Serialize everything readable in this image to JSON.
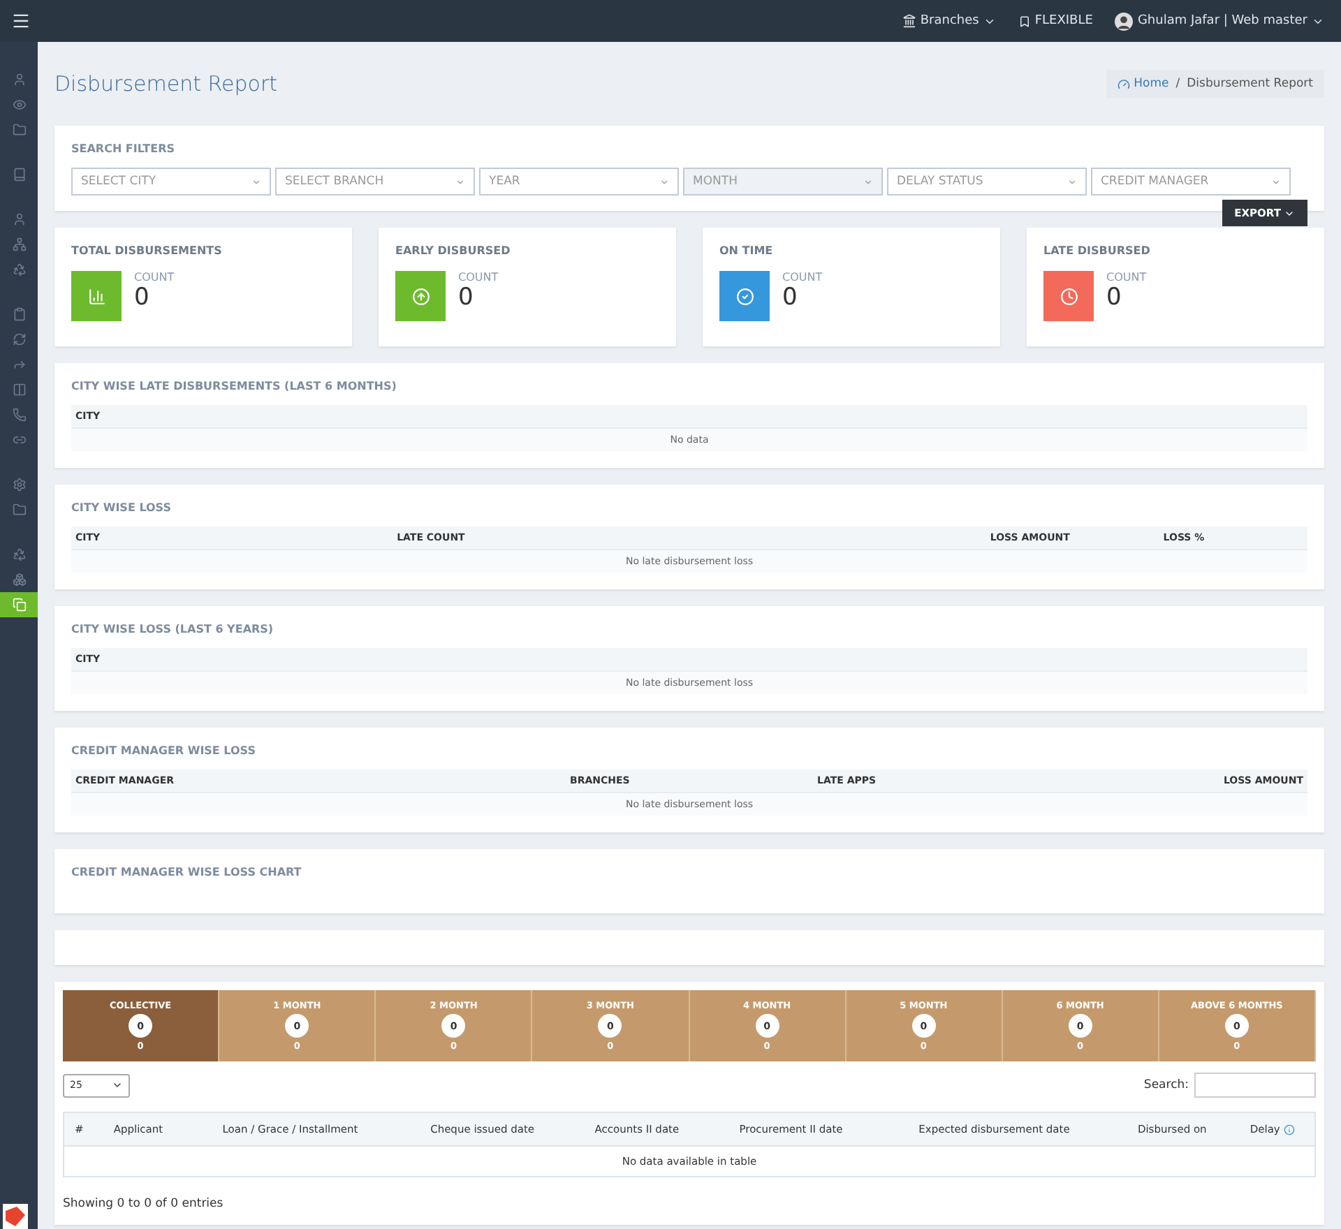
{
  "topbar": {
    "branches": "Branches",
    "plan": "FLEXIBLE",
    "user": "Ghulam Jafar | Web master"
  },
  "sidebar": {
    "items": [
      {
        "selected": false
      },
      {
        "selected": false
      },
      {
        "selected": false
      },
      {
        "selected": false
      },
      {
        "selected": false
      },
      {
        "selected": false
      },
      {
        "selected": false
      },
      {
        "selected": false
      },
      {
        "selected": false
      },
      {
        "selected": false
      },
      {
        "selected": false
      },
      {
        "selected": false
      },
      {
        "selected": false
      },
      {
        "selected": false
      },
      {
        "selected": false
      },
      {
        "selected": false
      },
      {
        "selected": false
      },
      {
        "selected": true
      }
    ]
  },
  "page_title": "Disbursement Report",
  "breadcrumb": [
    {
      "label": "Home"
    },
    {
      "label": "Disbursement Report"
    }
  ],
  "breadcrumb_separator": "/",
  "filters": {
    "title": "SEARCH FILTERS",
    "selects": [
      {
        "placeholder": "SELECT CITY",
        "disabled": false
      },
      {
        "placeholder": "SELECT BRANCH",
        "disabled": false
      },
      {
        "placeholder": "YEAR",
        "disabled": false
      },
      {
        "placeholder": "MONTH",
        "disabled": true
      },
      {
        "placeholder": "DELAY STATUS",
        "disabled": false
      },
      {
        "placeholder": "CREDIT MANAGER",
        "disabled": false
      }
    ],
    "export": "EXPORT"
  },
  "stats": [
    {
      "kind": "chart",
      "title": "TOTAL DISBURSEMENTS",
      "label": "COUNT",
      "value": "0",
      "color": "#6dbb2d"
    },
    {
      "kind": "up",
      "title": "EARLY DISBURSED",
      "label": "COUNT",
      "value": "0",
      "color": "#6dbb2d"
    },
    {
      "kind": "check",
      "title": "ON TIME",
      "label": "COUNT",
      "value": "0",
      "color": "#3598dc"
    },
    {
      "kind": "clock",
      "title": "LATE DISBURSED",
      "label": "COUNT",
      "value": "0",
      "color": "#f36a5a"
    }
  ],
  "sections": [
    {
      "title": "CITY WISE LATE DISBURSEMENTS (LAST 6 MONTHS)",
      "columns": [
        "CITY"
      ],
      "empty": "No data"
    },
    {
      "title": "CITY WISE LOSS",
      "columns": [
        "CITY",
        "LATE COUNT",
        "LOSS AMOUNT",
        "LOSS %"
      ],
      "empty": "No late disbursement loss"
    },
    {
      "title": "CITY WISE LOSS (LAST 6 YEARS)",
      "columns": [
        "CITY"
      ],
      "empty": "No late disbursement loss"
    },
    {
      "title": "CREDIT MANAGER WISE LOSS",
      "columns": [
        "CREDIT MANAGER",
        "BRANCHES",
        "LATE APPS",
        "LOSS AMOUNT"
      ],
      "empty": "No late disbursement loss"
    }
  ],
  "chart_section": {
    "title": "CREDIT MANAGER WISE LOSS CHART"
  },
  "buckets": [
    {
      "label": "COLLECTIVE",
      "count": "0",
      "amount": "0",
      "selected": true
    },
    {
      "label": "1 MONTH",
      "count": "0",
      "amount": "0",
      "selected": false
    },
    {
      "label": "2 MONTH",
      "count": "0",
      "amount": "0",
      "selected": false
    },
    {
      "label": "3 MONTH",
      "count": "0",
      "amount": "0",
      "selected": false
    },
    {
      "label": "4 MONTH",
      "count": "0",
      "amount": "0",
      "selected": false
    },
    {
      "label": "5 MONTH",
      "count": "0",
      "amount": "0",
      "selected": false
    },
    {
      "label": "6 MONTH",
      "count": "0",
      "amount": "0",
      "selected": false
    },
    {
      "label": "ABOVE 6 MONTHS",
      "count": "0",
      "amount": "0",
      "selected": false
    }
  ],
  "page_length": "25",
  "search_label": "Search:",
  "table": {
    "columns": [
      "#",
      "Applicant",
      "Loan / Grace / Installment",
      "Cheque issued date",
      "Accounts II date",
      "Procurement II date",
      "Expected disbursement date",
      "Disbursed on",
      "Delay"
    ],
    "empty": "No data available in table"
  },
  "info": "Showing 0 to 0 of 0 entries"
}
